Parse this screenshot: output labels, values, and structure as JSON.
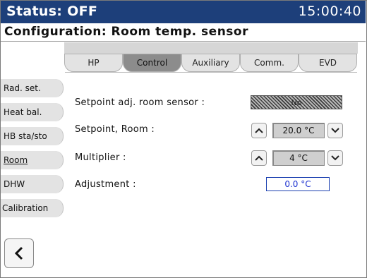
{
  "status": {
    "label": "Status: OFF",
    "time": "15:00:40"
  },
  "config_title": "Configuration: Room temp. sensor",
  "tabs": [
    {
      "label": "HP",
      "active": false
    },
    {
      "label": "Control",
      "active": true
    },
    {
      "label": "Auxiliary",
      "active": false
    },
    {
      "label": "Comm.",
      "active": false
    },
    {
      "label": "EVD",
      "active": false
    }
  ],
  "sidebar": {
    "items": [
      {
        "label": "Rad. set."
      },
      {
        "label": "Heat bal."
      },
      {
        "label": "HB sta/sto"
      },
      {
        "label": "Room"
      },
      {
        "label": "DHW"
      },
      {
        "label": "Calibration"
      }
    ],
    "active_index": 3
  },
  "settings": {
    "setpoint_adj": {
      "label": "Setpoint adj. room sensor :",
      "value": "No"
    },
    "setpoint_room": {
      "label": "Setpoint, Room :",
      "value": "20.0 °C"
    },
    "multiplier": {
      "label": "Multiplier :",
      "value": "4 °C"
    },
    "adjustment": {
      "label": "Adjustment :",
      "value": "0.0 °C"
    }
  },
  "icons": {
    "up": "chevron-up-icon",
    "down": "chevron-down-icon",
    "back": "chevron-left-icon"
  },
  "colors": {
    "statusbar": "#1d3f7a",
    "adjustment_text": "#1a2fd0"
  }
}
